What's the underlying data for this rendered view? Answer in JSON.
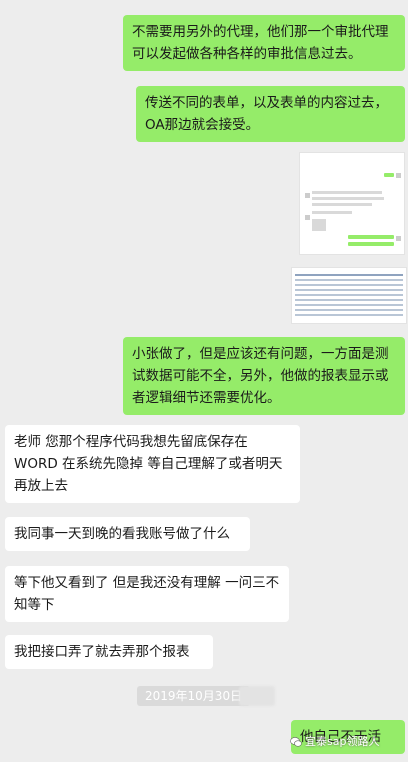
{
  "messages": {
    "m1": "不需要用另外的代理，他们那一个审批代理可以发起做各种各样的审批信息过去。",
    "m2": "传送不同的表单，以及表单的内容过去，OA那边就会接受。",
    "m3": "小张做了，但是应该还有问题，一方面是测试数据可能不全，另外，他做的报表显示或者逻辑细节还需要优化。",
    "m4": "老师  您那个程序代码我想先留底保存在WORD  在系统先隐掉   等自己理解了或者明天再放上去",
    "m5": "我同事一天到晚的看我账号做了什么",
    "m6": "等下他又看到了 但是我还没有理解  一问三不知等下",
    "m7": "我把接口弄了就去弄那个报表",
    "m8": "他自己不干活"
  },
  "date_separator": "2019年10月30日",
  "watermark": "宜泰sap领路人",
  "icons": {
    "watermark": "wechat-logo-icon"
  }
}
